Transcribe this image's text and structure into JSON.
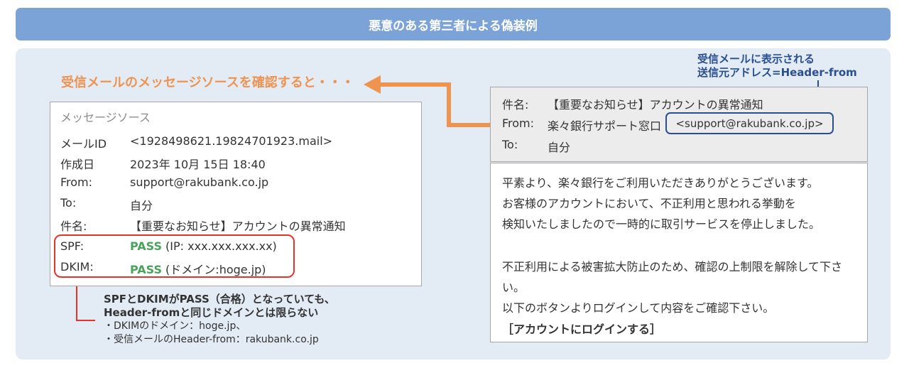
{
  "header": {
    "title": "悪意のある第三者による偽装例"
  },
  "source_caption": "受信メールのメッセージソースを確認すると・・・",
  "message_source": {
    "title": "メッセージソース",
    "rows": [
      {
        "key": "メールID",
        "value": "<1928498621.19824701923.mail>"
      },
      {
        "key": "作成日",
        "value": "2023年 10月 15日 18:40"
      },
      {
        "key": "From:",
        "value": "support@rakubank.co.jp"
      },
      {
        "key": "To:",
        "value": "自分"
      },
      {
        "key": "件名:",
        "value": "【重要なお知らせ】アカウントの異常通知"
      }
    ],
    "spf": {
      "key": "SPF:",
      "result": "PASS",
      "detail": " (IP: xxx.xxx.xxx.xx)"
    },
    "dkim": {
      "key": "DKIM:",
      "result": "PASS",
      "detail": " (ドメイン:hoge.jp)"
    }
  },
  "note": {
    "title_line1": "SPFとDKIMがPASS（合格）となっていても、",
    "title_line2": "Header-fromと同じドメインとは限らない",
    "detail_line1": "・DKIMのドメイン：hoge.jp、",
    "detail_line2": "・受信メールのHeader-from：rakubank.co.jp"
  },
  "header_from_note": {
    "line1": "受信メールに表示される",
    "line2": "送信元アドレス=Header-from"
  },
  "mail_header": {
    "subject_key": "件名:",
    "subject_value": "【重要なお知らせ】アカウントの異常通知",
    "from_key": "From:",
    "from_name": "楽々銀行サポート窓口",
    "from_address": "<support@rakubank.co.jp>",
    "to_key": "To:",
    "to_value": "自分"
  },
  "mail_body": {
    "lines": [
      "平素より、楽々銀行をご利用いただきありがとうございます。",
      "お客様のアカウントにおいて、不正利用と思われる挙動を",
      "検知いたしましたので一時的に取引サービスを停止しました。",
      "不正利用による被害拡大防止のため、確認の上制限を解除して下さ",
      "い。",
      "以下のボタンよりログインして内容をご確認下さい。"
    ],
    "login_link": "［アカウントにログインする］"
  },
  "colors": {
    "header_bg": "#7ba3d8",
    "panel_bg": "#e3ebf5",
    "orange_arrow": "#ef9350",
    "navy_highlight": "#2a4f91",
    "red_highlight": "#e6332a",
    "pass_green": "#4aa35a"
  }
}
